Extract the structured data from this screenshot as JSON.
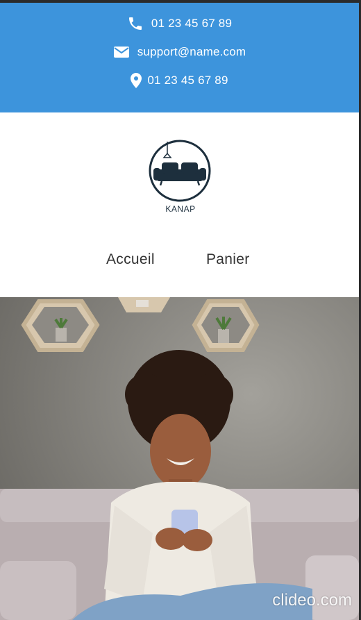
{
  "contact": {
    "phone": "01 23 45 67 89",
    "email": "support@name.com",
    "address": "01 23 45 67 89",
    "phone_icon": "phone-icon",
    "email_icon": "envelope-icon",
    "address_icon": "map-pin-icon"
  },
  "brand": {
    "name": "KANAP",
    "logo_icon": "sofa-lamp-logo"
  },
  "nav": {
    "home": "Accueil",
    "cart": "Panier"
  },
  "watermark": "clideo.com",
  "colors": {
    "topbar": "#3d94dc",
    "logo": "#1d2f3d"
  }
}
